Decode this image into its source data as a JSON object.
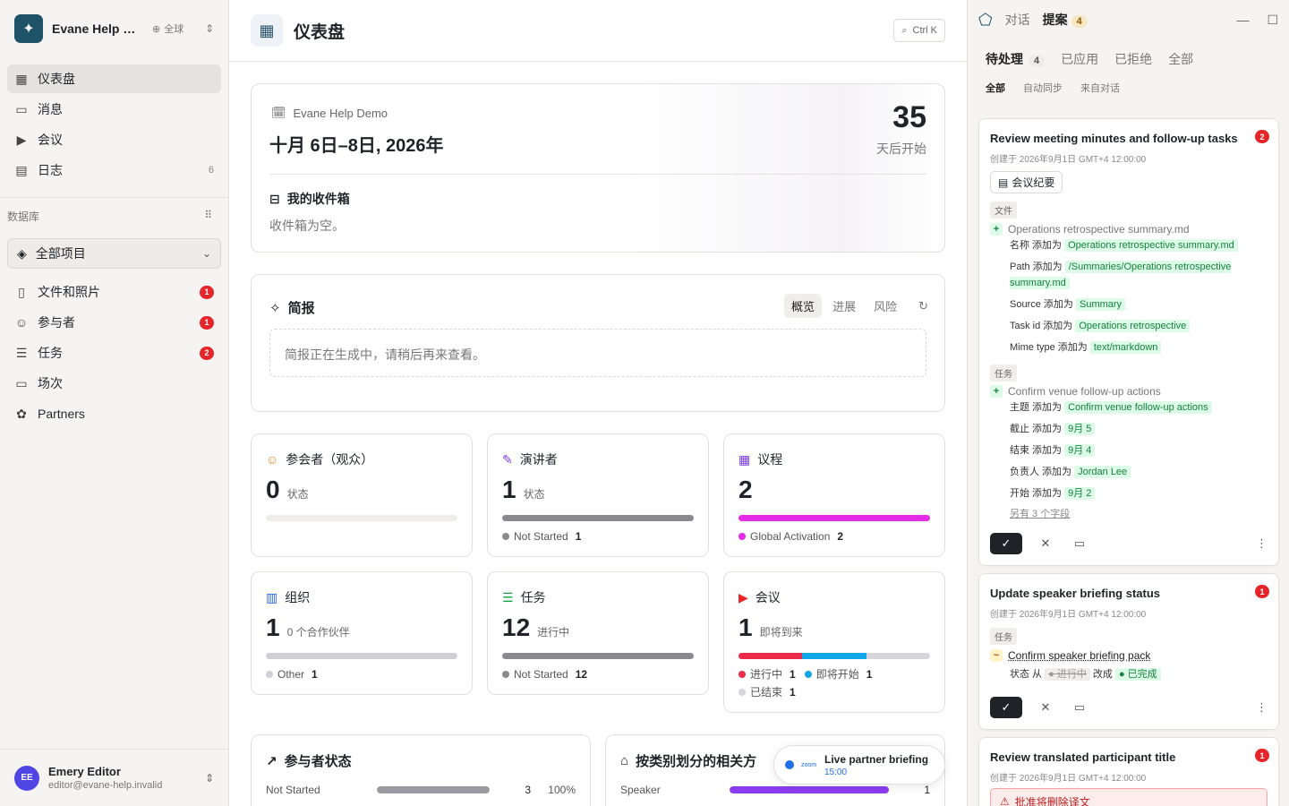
{
  "workspace": {
    "name": "Evane Help Demo",
    "scope": "全球"
  },
  "nav": [
    {
      "label": "仪表盘",
      "icon": "grid-icon",
      "count": "",
      "active": true
    },
    {
      "label": "消息",
      "icon": "message-icon",
      "count": ""
    },
    {
      "label": "会议",
      "icon": "video-icon",
      "count": ""
    },
    {
      "label": "日志",
      "icon": "log-icon",
      "count": "6"
    }
  ],
  "db_section": {
    "label": "数据库",
    "project": "全部项目"
  },
  "db_items": [
    {
      "label": "文件和照片",
      "icon": "file-icon",
      "badge": "1"
    },
    {
      "label": "参与者",
      "icon": "users-icon",
      "badge": "1"
    },
    {
      "label": "任务",
      "icon": "tasks-icon",
      "badge": "2"
    },
    {
      "label": "场次",
      "icon": "session-icon",
      "badge": ""
    },
    {
      "label": "Partners",
      "icon": "partners-icon",
      "badge": ""
    }
  ],
  "user": {
    "initials": "EE",
    "name": "Emery Editor",
    "email": "editor@evane-help.invalid"
  },
  "header": {
    "title": "仪表盘",
    "search_hint": "Ctrl K"
  },
  "event": {
    "name": "Evane Help Demo",
    "dates": "十月 6日–8日, 2026年",
    "days": "35",
    "days_label": "天后开始",
    "inbox_title": "我的收件箱",
    "inbox_empty": "收件箱为空。"
  },
  "briefing": {
    "title": "简报",
    "tabs": [
      "概览",
      "进展",
      "风险"
    ],
    "message": "简报正在生成中，请稍后再来查看。"
  },
  "stats": [
    {
      "title": "参会者（观众）",
      "icon": "users-icon",
      "color": "#e08a2a",
      "value": "0",
      "sub": "状态",
      "segments": [],
      "legend": []
    },
    {
      "title": "演讲者",
      "icon": "mic-icon",
      "color": "#7c3aed",
      "value": "1",
      "sub": "状态",
      "segments": [
        {
          "color": "#8a8a8e",
          "frac": 1
        }
      ],
      "legend": [
        {
          "label": "Not Started",
          "count": "1",
          "color": "#8a8a8e"
        }
      ]
    },
    {
      "title": "议程",
      "icon": "calendar-icon",
      "color": "#7c3aed",
      "value": "2",
      "sub": "",
      "segments": [
        {
          "color": "#e52ae8",
          "frac": 1
        }
      ],
      "legend": [
        {
          "label": "Global Activation",
          "count": "2",
          "color": "#e52ae8"
        }
      ]
    },
    {
      "title": "组织",
      "icon": "building-icon",
      "color": "#2563eb",
      "value": "1",
      "sub": "0 个合作伙伴",
      "segments": [
        {
          "color": "#d0d0d4",
          "frac": 1
        }
      ],
      "legend": [
        {
          "label": "Other",
          "count": "1",
          "color": "#d0d0d4"
        }
      ]
    },
    {
      "title": "任务",
      "icon": "tasks-icon",
      "color": "#16a34a",
      "value": "12",
      "sub": "进行中",
      "segments": [
        {
          "color": "#8a8a8e",
          "frac": 1
        }
      ],
      "legend": [
        {
          "label": "Not Started",
          "count": "12",
          "color": "#8a8a8e"
        }
      ]
    },
    {
      "title": "会议",
      "icon": "video-icon",
      "color": "#e5252a",
      "value": "1",
      "sub": "即将到来",
      "segments": [
        {
          "color": "#ee2a4a",
          "frac": 0.333
        },
        {
          "color": "#0ea5e9",
          "frac": 0.333
        },
        {
          "color": "#d6d6da",
          "frac": 0.334
        }
      ],
      "legend": [
        {
          "label": "进行中",
          "count": "1",
          "color": "#ee2a4a"
        },
        {
          "label": "即将开始",
          "count": "1",
          "color": "#0ea5e9"
        },
        {
          "label": "已结束",
          "count": "1",
          "color": "#d6d6da"
        }
      ]
    }
  ],
  "participant_status": {
    "title": "参与者状态",
    "rows": [
      {
        "label": "Not Started",
        "count": "3",
        "pct": "100%",
        "frac": 1
      }
    ]
  },
  "related": {
    "title": "按类别划分的相关方",
    "rows": [
      {
        "label": "Speaker",
        "count": "1",
        "frac": 0.82
      }
    ]
  },
  "toast": {
    "app": "zoom",
    "title": "Live partner briefing",
    "time": "15:00"
  },
  "panel": {
    "tabs": [
      {
        "label": "对话"
      },
      {
        "label": "提案",
        "count": "4"
      }
    ],
    "status_tabs": [
      {
        "label": "待处理",
        "count": "4"
      },
      {
        "label": "已应用"
      },
      {
        "label": "已拒绝"
      },
      {
        "label": "全部"
      }
    ],
    "source_tabs": [
      "全部",
      "自动同步",
      "来自对话"
    ],
    "proposals": [
      {
        "title": "Review meeting minutes and follow-up tasks",
        "badge": "2",
        "meta": "创建于 2026年9月1日 GMT+4 12:00:00",
        "chip": "会议纪要",
        "file_section": "文件",
        "file_name": "Operations retrospective summary.md",
        "file_fields": [
          {
            "k": "名称 添加为",
            "v": "Operations retrospective summary.md"
          },
          {
            "k": "Path 添加为",
            "v": "/Summaries/Operations retrospective summary.md"
          },
          {
            "k": "Source 添加为",
            "v": "Summary"
          },
          {
            "k": "Task id 添加为",
            "v": "Operations retrospective"
          },
          {
            "k": "Mime type 添加为",
            "v": "text/markdown"
          }
        ],
        "task_section": "任务",
        "task_name": "Confirm venue follow-up actions",
        "task_fields": [
          {
            "k": "主题 添加为",
            "v": "Confirm venue follow-up actions"
          },
          {
            "k": "截止 添加为",
            "v": "9月 5"
          },
          {
            "k": "结束 添加为",
            "v": "9月 4"
          },
          {
            "k": "负责人 添加为",
            "v": "Jordan Lee"
          },
          {
            "k": "开始 添加为",
            "v": "9月 2"
          }
        ],
        "more": "另有 3 个字段"
      },
      {
        "title": "Update speaker briefing status",
        "badge": "1",
        "meta": "创建于 2026年9月1日 GMT+4 12:00:00",
        "section": "任务",
        "task_name": "Confirm speaker briefing pack",
        "from_label": "状态 从",
        "old": "进行中",
        "change": "改成",
        "new": "已完成"
      },
      {
        "title": "Review translated participant title",
        "badge": "1",
        "meta": "创建于 2026年9月1日 GMT+4 12:00:00",
        "warning": "批准将删除译文"
      }
    ]
  }
}
